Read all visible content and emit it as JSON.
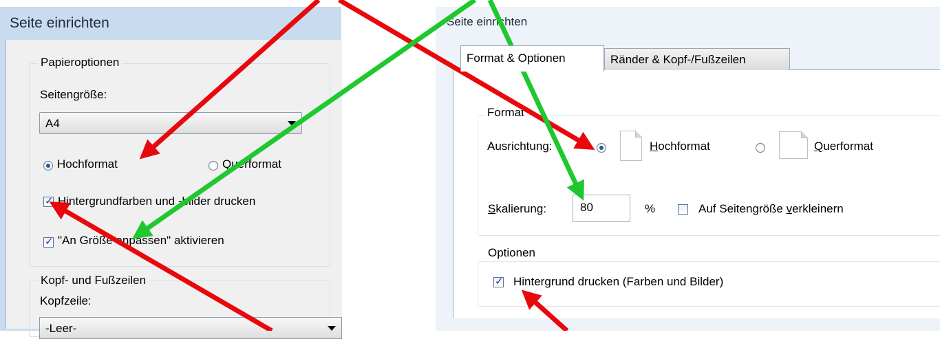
{
  "left_dialog": {
    "title": "Seite einrichten",
    "paper_options": {
      "legend": "Papieroptionen",
      "page_size_label": "Seitengröße:",
      "page_size_value": "A4",
      "orientation": {
        "portrait": "Hochformat",
        "landscape": "Querformat",
        "selected": "portrait"
      },
      "print_background": {
        "label": "Hintergrundfarben und -bilder drucken",
        "checked": true
      },
      "shrink_to_fit": {
        "label": "\"An Größe anpassen\" aktivieren",
        "checked": true
      }
    },
    "header_footer": {
      "legend": "Kopf- und Fußzeilen",
      "header_label": "Kopfzeile:",
      "header_value": "-Leer-"
    }
  },
  "right_dialog": {
    "title": "Seite einrichten",
    "tabs": [
      {
        "label": "Format & Optionen",
        "active": true
      },
      {
        "label": "Ränder & Kopf-/Fußzeilen",
        "active": false
      }
    ],
    "format": {
      "legend": "Format",
      "orientation_label_underlined": "Ausrichtung:",
      "orientation": {
        "portrait_accel": "H",
        "portrait_rest": "ochformat",
        "landscape_accel": "Q",
        "landscape_rest": "uerformat",
        "selected": "portrait"
      },
      "scaling_accel": "S",
      "scaling_rest": "kalierung:",
      "scaling_value": "80",
      "percent_sign": "%",
      "shrink_pre": "Auf Seitengröße ",
      "shrink_accel": "v",
      "shrink_post": "erkleinern",
      "shrink_checked": false
    },
    "options": {
      "legend": "Optionen",
      "bg_pre": "Hinter",
      "bg_accel": "g",
      "bg_post": "rund drucken (Farben und Bilder)",
      "bg_checked": true
    }
  },
  "annotations": {
    "red": "#e8080c",
    "green": "#1fc82e"
  }
}
